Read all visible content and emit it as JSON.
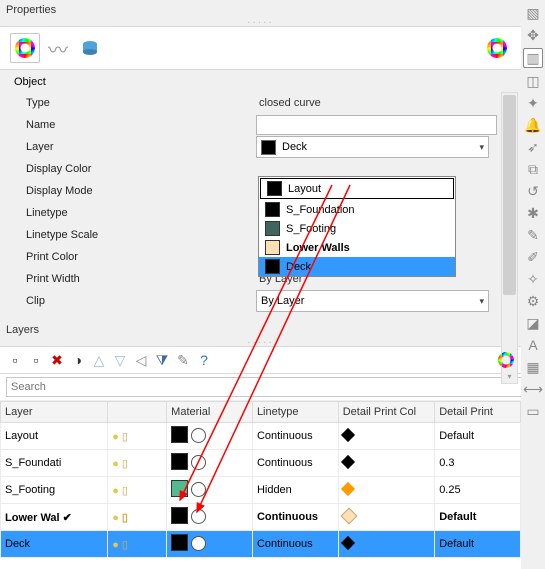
{
  "properties": {
    "title": "Properties",
    "section_title": "Object",
    "rows": {
      "type": {
        "label": "Type",
        "value": "closed curve"
      },
      "name": {
        "label": "Name",
        "value": ""
      },
      "layer": {
        "label": "Layer",
        "value": "Deck",
        "swatch": "#000000"
      },
      "display_color": {
        "label": "Display Color"
      },
      "display_mode": {
        "label": "Display Mode"
      },
      "linetype": {
        "label": "Linetype"
      },
      "linetype_scale": {
        "label": "Linetype Scale"
      },
      "print_color": {
        "label": "Print Color"
      },
      "print_width": {
        "label": "Print Width",
        "value": "By Layer"
      },
      "clip": {
        "label": "Clip",
        "value": "By Layer"
      }
    },
    "dropdown": {
      "items": [
        {
          "label": "Layout",
          "swatch": "#000000",
          "boxed": true
        },
        {
          "label": "S_Foundation",
          "swatch": "#000000"
        },
        {
          "label": "S_Footing",
          "swatch": "#3f655c"
        },
        {
          "label": "Lower Walls",
          "swatch": "#ffe0b5",
          "bold": true
        },
        {
          "label": "Deck",
          "swatch": "#000000",
          "selected": true
        }
      ]
    }
  },
  "layers": {
    "title": "Layers",
    "search_placeholder": "Search",
    "columns": {
      "c1": "Layer",
      "c2": "",
      "c3": "Material",
      "c4": "Linetype",
      "c5": "Detail Print Col",
      "c6": "Detail Print"
    },
    "rows": [
      {
        "name": "Layout",
        "swatch": "#000000",
        "linetype": "Continuous",
        "detail_print": "Default"
      },
      {
        "name": "S_Foundati",
        "swatch": "#000000",
        "linetype": "Continuous",
        "detail_print": "0.3"
      },
      {
        "name": "S_Footing",
        "swatch": "#53b98f",
        "linetype": "Hidden",
        "detail_print": "0.25"
      },
      {
        "name": "Lower Wal",
        "swatch": "#000000",
        "linetype": "Continuous",
        "detail_print": "Default",
        "bold": true,
        "current_check": true
      },
      {
        "name": "Deck",
        "swatch": "#000000",
        "linetype": "Continuous",
        "detail_print": "Default",
        "selected": true
      }
    ]
  }
}
